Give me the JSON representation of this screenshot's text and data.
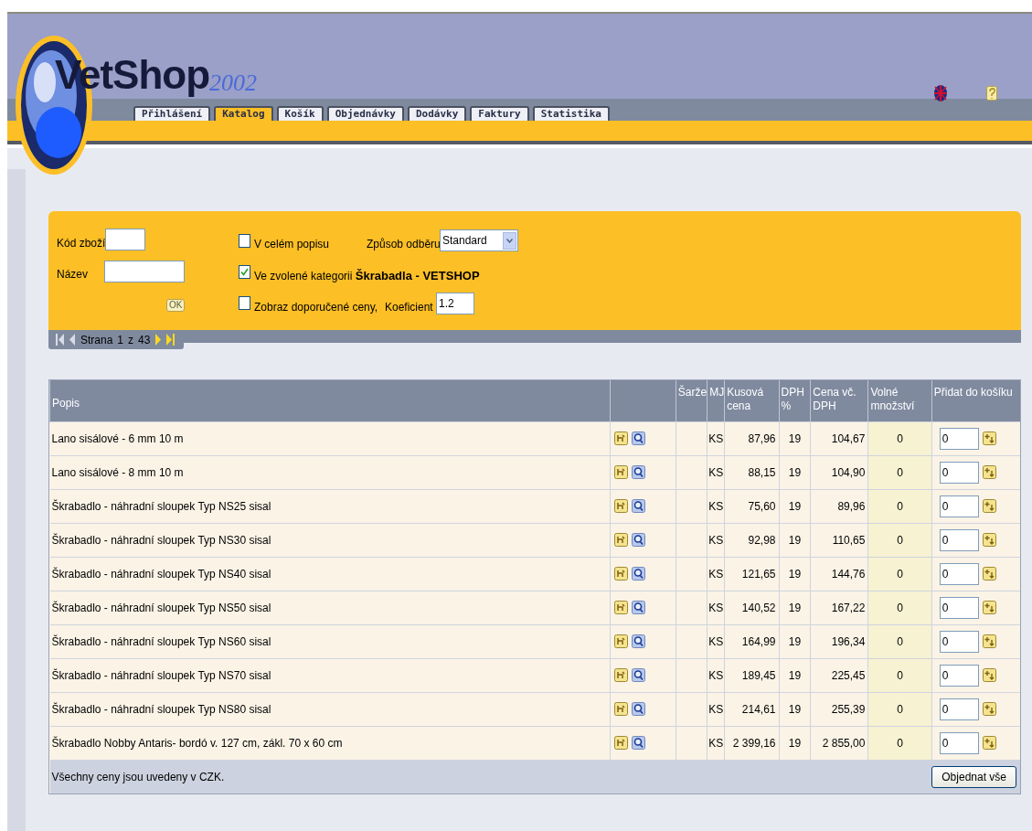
{
  "logo": {
    "name": "VetShop",
    "year": "2002"
  },
  "tabs": [
    {
      "label": "Přihlášení",
      "selected": false
    },
    {
      "label": "Katalog",
      "selected": true
    },
    {
      "label": "Košík",
      "selected": false
    },
    {
      "label": "Objednávky",
      "selected": false
    },
    {
      "label": "Dodávky",
      "selected": false
    },
    {
      "label": "Faktury",
      "selected": false
    },
    {
      "label": "Statistika",
      "selected": false
    }
  ],
  "filter": {
    "code_label": "Kód zboží",
    "name_label": "Název",
    "ok_button": "OK",
    "whole_description": {
      "label": "V celém popisu",
      "checked": false
    },
    "method_label": "Způsob odběru",
    "method_value": "Standard",
    "category": {
      "label": "Ve zvolené kategorii ",
      "category": "Škrabadla - VETSHOP",
      "checked": true
    },
    "recommended": {
      "label": "Zobraz doporučené ceny,",
      "checked": false
    },
    "coefficient_label": "Koeficient",
    "coefficient_value": "1.2"
  },
  "pagination": {
    "page_label": "Strana",
    "page": "1",
    "of": "z",
    "total": "43"
  },
  "table": {
    "columns": [
      "Popis",
      "",
      "Šarže",
      "MJ",
      "Kusová cena",
      "DPH %",
      "Cena vč. DPH",
      "Volné množství",
      "Přidat do košíku"
    ],
    "rows": [
      {
        "popis": "Lano sisálové - 6 mm 10 m",
        "mj": "KS",
        "price": "87,96",
        "vat": "19",
        "price_vat": "104,67",
        "free": "0",
        "qty": "0"
      },
      {
        "popis": "Lano sisálové - 8 mm 10 m",
        "mj": "KS",
        "price": "88,15",
        "vat": "19",
        "price_vat": "104,90",
        "free": "0",
        "qty": "0"
      },
      {
        "popis": "Škrabadlo - náhradní sloupek Typ NS25 sisal",
        "mj": "KS",
        "price": "75,60",
        "vat": "19",
        "price_vat": "89,96",
        "free": "0",
        "qty": "0"
      },
      {
        "popis": "Škrabadlo - náhradní sloupek Typ NS30 sisal",
        "mj": "KS",
        "price": "92,98",
        "vat": "19",
        "price_vat": "110,65",
        "free": "0",
        "qty": "0"
      },
      {
        "popis": "Škrabadlo - náhradní sloupek Typ NS40 sisal",
        "mj": "KS",
        "price": "121,65",
        "vat": "19",
        "price_vat": "144,76",
        "free": "0",
        "qty": "0"
      },
      {
        "popis": "Škrabadlo - náhradní sloupek Typ NS50 sisal",
        "mj": "KS",
        "price": "140,52",
        "vat": "19",
        "price_vat": "167,22",
        "free": "0",
        "qty": "0"
      },
      {
        "popis": "Škrabadlo - náhradní sloupek Typ NS60 sisal",
        "mj": "KS",
        "price": "164,99",
        "vat": "19",
        "price_vat": "196,34",
        "free": "0",
        "qty": "0"
      },
      {
        "popis": "Škrabadlo - náhradní sloupek Typ NS70 sisal",
        "mj": "KS",
        "price": "189,45",
        "vat": "19",
        "price_vat": "225,45",
        "free": "0",
        "qty": "0"
      },
      {
        "popis": "Škrabadlo - náhradní sloupek Typ NS80 sisal",
        "mj": "KS",
        "price": "214,61",
        "vat": "19",
        "price_vat": "255,39",
        "free": "0",
        "qty": "0"
      },
      {
        "popis": "Škrabadlo Nobby Antaris- bordó v. 127 cm, zákl. 70 x 60 cm",
        "mj": "KS",
        "price": "2 399,16",
        "vat": "19",
        "price_vat": "2 855,00",
        "free": "0",
        "qty": "0"
      }
    ],
    "footer_note": "Všechny ceny jsou uvedeny v CZK.",
    "order_all": "Objednat vše"
  }
}
